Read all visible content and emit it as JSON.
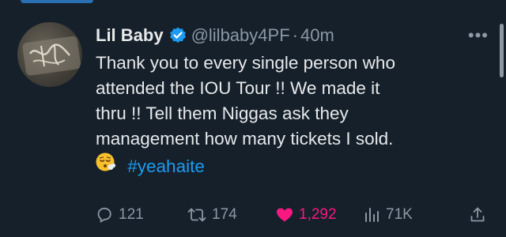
{
  "tweet": {
    "display_name": "Lil Baby",
    "handle": "@lilbaby4PF",
    "separator": "·",
    "time": "40m",
    "more_label": "•••",
    "text_lines": [
      "Thank you to every single person who",
      "attended the IOU Tour !!  We  made it",
      "thru !! Tell them Niggas ask they",
      "management how many tickets I sold."
    ],
    "hashtag": "#yeahaite",
    "emoji_name": "face-exhaling-emoji"
  },
  "actions": {
    "replies": "121",
    "retweets": "174",
    "likes": "1,292",
    "views": "71K"
  },
  "colors": {
    "background": "#15202b",
    "text": "#e7e9ea",
    "muted": "#8b98a5",
    "accent": "#1d9bf0",
    "like": "#f91880"
  },
  "icons": [
    "verified-badge-icon",
    "more-icon",
    "reply-icon",
    "retweet-icon",
    "heart-icon",
    "views-icon",
    "share-icon"
  ]
}
